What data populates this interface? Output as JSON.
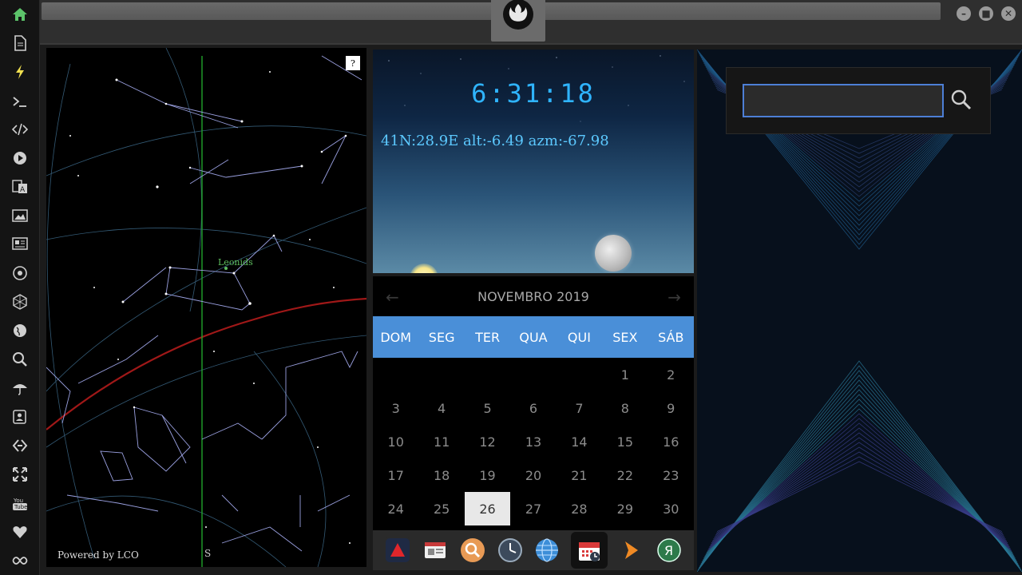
{
  "sidebar": {
    "items": [
      {
        "icon": "home-icon",
        "active": true
      },
      {
        "icon": "document-icon"
      },
      {
        "icon": "bolt-icon"
      },
      {
        "icon": "terminal-icon"
      },
      {
        "icon": "code-icon"
      },
      {
        "icon": "play-icon"
      },
      {
        "icon": "translate-icon"
      },
      {
        "icon": "image-icon"
      },
      {
        "icon": "newspaper-icon"
      },
      {
        "icon": "rebel-icon"
      },
      {
        "icon": "hexagon-icon"
      },
      {
        "icon": "globe-icon"
      },
      {
        "icon": "search-icon"
      },
      {
        "icon": "umbrella-icon"
      },
      {
        "icon": "contact-icon"
      },
      {
        "icon": "link-icon"
      },
      {
        "icon": "expand-icon"
      },
      {
        "icon": "youtube-icon",
        "label": "You Tube"
      },
      {
        "icon": "heart-icon"
      },
      {
        "icon": "infinity-icon"
      }
    ]
  },
  "skymap": {
    "help_label": "?",
    "powered_by": "Powered by LCO",
    "direction_label": "S",
    "meteor_shower_label": "Leonids"
  },
  "sun_widget": {
    "time": "6:31:18",
    "coords": "41N:28.9E  alt:-6.49 azm:-67.98"
  },
  "calendar": {
    "month_label": "NOVEMBRO 2019",
    "prev_label": "←",
    "next_label": "→",
    "weekdays": [
      "DOM",
      "SEG",
      "TER",
      "QUA",
      "QUI",
      "SEX",
      "SÁB"
    ],
    "days": [
      "",
      "",
      "",
      "",
      "",
      "1",
      "2",
      "3",
      "4",
      "5",
      "6",
      "7",
      "8",
      "9",
      "10",
      "11",
      "12",
      "13",
      "14",
      "15",
      "16",
      "17",
      "18",
      "19",
      "20",
      "21",
      "22",
      "23",
      "24",
      "25",
      "26",
      "27",
      "28",
      "29",
      "30"
    ],
    "today": "26",
    "accent_color": "#4a8fd8"
  },
  "dock": {
    "items": [
      {
        "icon": "app-red-a-icon"
      },
      {
        "icon": "news-icon"
      },
      {
        "icon": "magnifier-icon"
      },
      {
        "icon": "clock-icon"
      },
      {
        "icon": "globe-icon"
      },
      {
        "icon": "calendar-icon",
        "selected": true
      },
      {
        "icon": "arrow-icon"
      },
      {
        "icon": "yandex-icon",
        "label": "Я"
      }
    ]
  },
  "search": {
    "placeholder": "",
    "value": ""
  },
  "window": {
    "min_label": "–",
    "max_label": "■",
    "close_label": "✕"
  }
}
